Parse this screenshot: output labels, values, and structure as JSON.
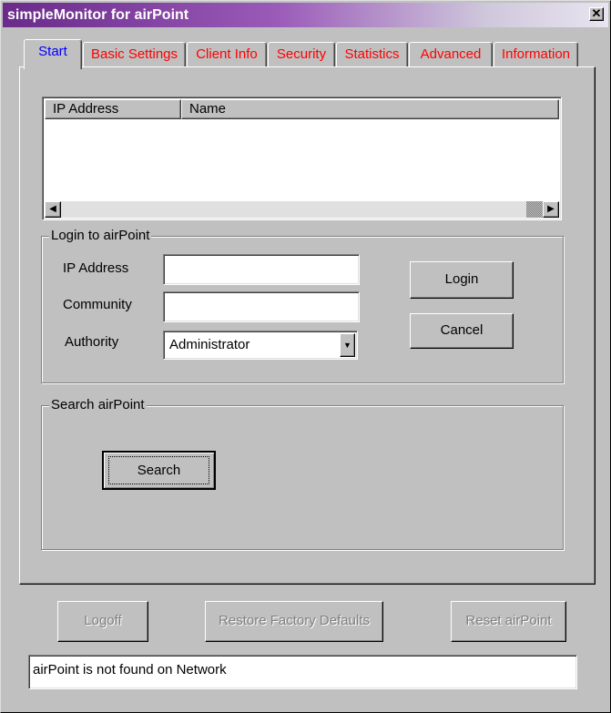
{
  "window": {
    "title": "simpleMonitor for airPoint",
    "close_glyph": "✕"
  },
  "tabs": [
    {
      "label": "Start",
      "active": true
    },
    {
      "label": "Basic Settings"
    },
    {
      "label": "Client Info"
    },
    {
      "label": "Security"
    },
    {
      "label": "Statistics"
    },
    {
      "label": "Advanced"
    },
    {
      "label": "Information"
    }
  ],
  "device_list": {
    "columns": [
      "IP Address",
      "Name"
    ],
    "rows": [],
    "scroll_left_glyph": "◀",
    "scroll_right_glyph": "▶"
  },
  "login": {
    "title": "Login to airPoint",
    "ip_label": "IP Address",
    "ip_value": "",
    "community_label": "Community",
    "community_value": "",
    "authority_label": "Authority",
    "authority_value": "Administrator",
    "dropdown_glyph": "▼",
    "login_button": "Login",
    "cancel_button": "Cancel"
  },
  "search": {
    "title": "Search airPoint",
    "search_button": "Search"
  },
  "footer": {
    "logoff_button": "Logoff",
    "restore_button": "Restore Factory Defaults",
    "reset_button": "Reset airPoint"
  },
  "status": {
    "message": "airPoint is not found on Network"
  },
  "colors": {
    "active_tab": "#0000ff",
    "inactive_tab": "#ff0000",
    "face": "#c0c0c0"
  }
}
